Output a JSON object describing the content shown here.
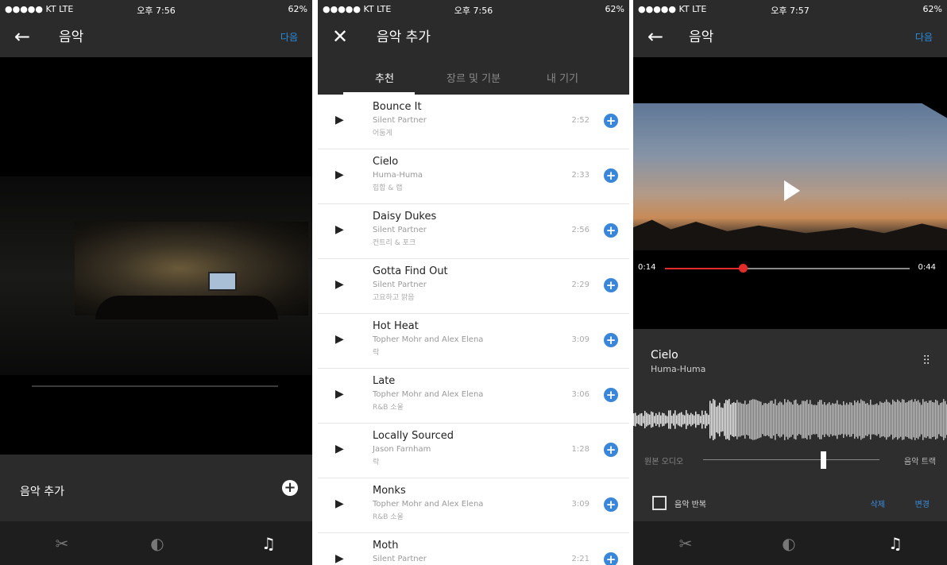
{
  "status": {
    "carrier1": "●●●●● KT  LTE",
    "carrier2": "●●●●● KT  LTE",
    "carrier3": "●●●●● KT  LTE",
    "time1": "오후 7:56",
    "time2": "오후 7:56",
    "time3": "오후 7:57",
    "battery": "62%"
  },
  "screen1": {
    "back_icon": "←",
    "title": "음악",
    "next": "다음",
    "add_music": "음악 추가",
    "add_icon": "+",
    "tools": [
      "✂",
      "◐",
      "♫"
    ]
  },
  "screen2": {
    "close_icon": "✕",
    "title": "음악 추가",
    "tabs": [
      "추천",
      "장르 및 기분",
      "내 기기"
    ],
    "tracks": [
      {
        "title": "Bounce It",
        "artist": "Silent Partner",
        "genre": "어둠게",
        "duration": "2:52"
      },
      {
        "title": "Cielo",
        "artist": "Huma-Huma",
        "genre": "힙합 & 랩",
        "duration": "2:33"
      },
      {
        "title": "Daisy Dukes",
        "artist": "Silent Partner",
        "genre": "컨트리 & 포크",
        "duration": "2:56"
      },
      {
        "title": "Gotta Find Out",
        "artist": "Silent Partner",
        "genre": "고요하고 맑음",
        "duration": "2:29"
      },
      {
        "title": "Hot Heat",
        "artist": "Topher Mohr and Alex Elena",
        "genre": "락",
        "duration": "3:09"
      },
      {
        "title": "Late",
        "artist": "Topher Mohr and Alex Elena",
        "genre": "R&B 소울",
        "duration": "3:06"
      },
      {
        "title": "Locally Sourced",
        "artist": "Jason Farnham",
        "genre": "락",
        "duration": "1:28"
      },
      {
        "title": "Monks",
        "artist": "Topher Mohr and Alex Elena",
        "genre": "R&B 소울",
        "duration": "3:09"
      },
      {
        "title": "Moth",
        "artist": "Silent Partner",
        "genre": "",
        "duration": "2:21"
      }
    ],
    "play_icon": "▶",
    "add_icon": "+"
  },
  "screen3": {
    "back_icon": "←",
    "title": "음악",
    "next": "다음",
    "time_current": "0:14",
    "time_total": "0:44",
    "progress": 0.318,
    "song_title": "Cielo",
    "song_artist": "Huma-Huma",
    "eq_icon": "⫶⫶",
    "mix_left": "원본 오디오",
    "mix_right": "음악 트랙",
    "mix_level": 0.68,
    "loop_label": "음악 반복",
    "delete": "삭제",
    "change": "변경",
    "tools": [
      "✂",
      "◐",
      "♫"
    ]
  },
  "colors": {
    "accent_blue": "#2a8de0",
    "progress_red": "#e32b2b",
    "bar_dark": "#2b2b2b"
  }
}
